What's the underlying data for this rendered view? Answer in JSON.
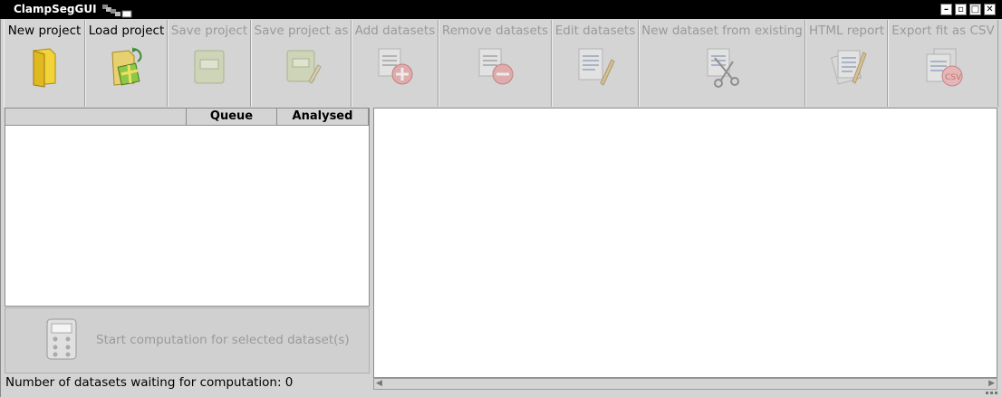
{
  "window": {
    "title": "ClampSegGUI",
    "buttons": [
      {
        "name": "minimize",
        "glyph": "–"
      },
      {
        "name": "restore",
        "glyph": "▫"
      },
      {
        "name": "maximize",
        "glyph": "□"
      },
      {
        "name": "close",
        "glyph": "✕"
      }
    ]
  },
  "toolbar": {
    "items": [
      {
        "label": "New project",
        "icon": "folder-icon",
        "enabled": true
      },
      {
        "label": "Load project",
        "icon": "load-folder-icon",
        "enabled": true
      },
      {
        "label": "Save project",
        "icon": "save-icon",
        "enabled": false
      },
      {
        "label": "Save project as",
        "icon": "save-as-icon",
        "enabled": false
      },
      {
        "label": "Add datasets",
        "icon": "add-dataset-icon",
        "enabled": false
      },
      {
        "label": "Remove datasets",
        "icon": "remove-dataset-icon",
        "enabled": false
      },
      {
        "label": "Edit datasets",
        "icon": "edit-dataset-icon",
        "enabled": false
      },
      {
        "label": "New dataset from existing",
        "icon": "scissors-icon",
        "enabled": false
      },
      {
        "label": "HTML report",
        "icon": "report-icon",
        "enabled": false
      },
      {
        "label": "Export fit as CSV",
        "icon": "csv-export-icon",
        "enabled": false
      }
    ]
  },
  "table": {
    "columns": [
      "",
      "Queue",
      "Analysed"
    ]
  },
  "compute": {
    "label": "Start computation for selected dataset(s)",
    "icon": "calculator-icon"
  },
  "status": {
    "text": "Number of datasets waiting for computation: 0"
  }
}
